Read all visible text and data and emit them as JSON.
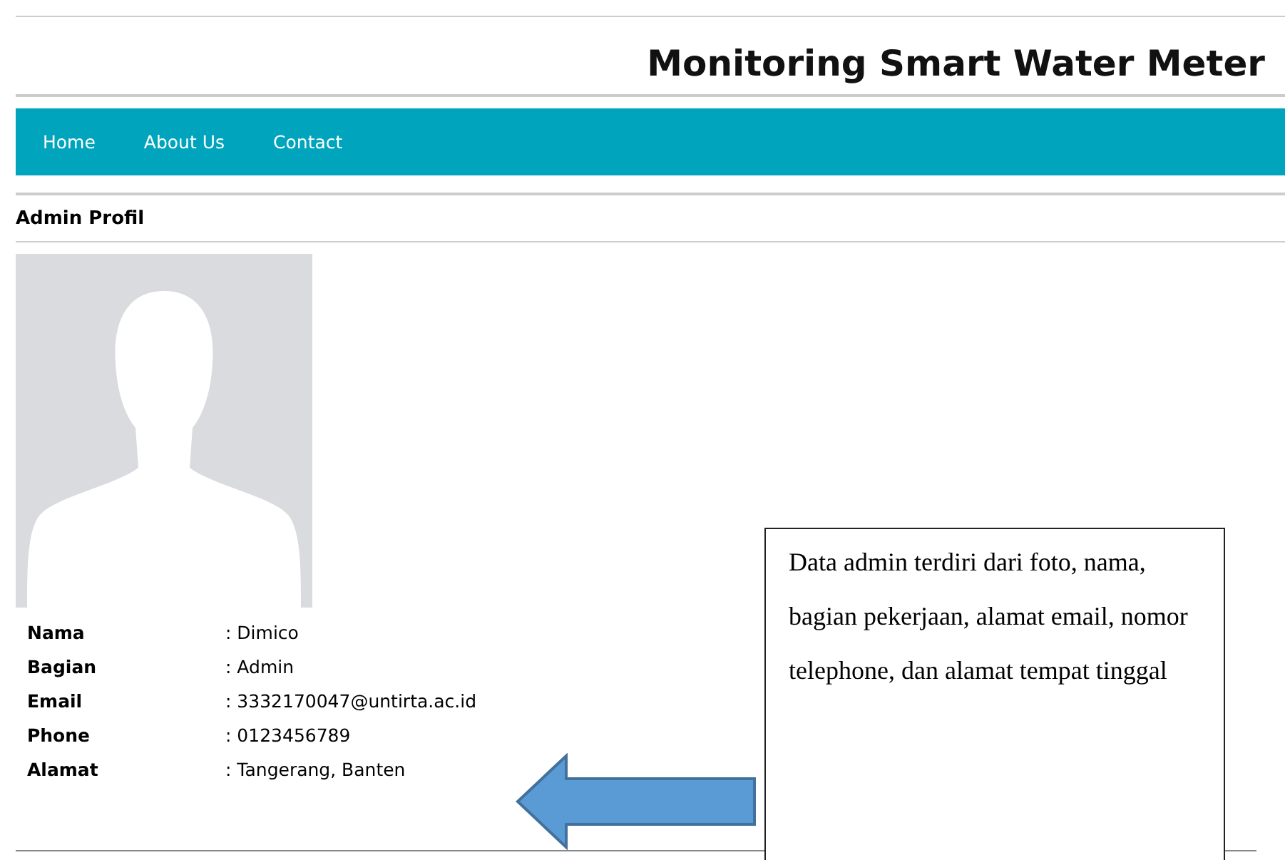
{
  "header": {
    "title": "Monitoring Smart Water Meter"
  },
  "nav": [
    {
      "label": "Home"
    },
    {
      "label": "About Us"
    },
    {
      "label": "Contact"
    }
  ],
  "section_title": "Admin Profil",
  "profile": {
    "photo": {
      "kind": "avatar"
    },
    "fields": [
      {
        "label": "Nama",
        "value": ": Dimico"
      },
      {
        "label": "Bagian",
        "value": ": Admin"
      },
      {
        "label": "Email",
        "value": ": 3332170047@untirta.ac.id"
      },
      {
        "label": "Phone",
        "value": ": 0123456789"
      },
      {
        "label": "Alamat",
        "value": ": Tangerang, Banten"
      }
    ]
  },
  "callout": {
    "text": "Data admin terdiri dari foto, nama, bagian pekerjaan, alamat email, nomor telephone, dan alamat tempat tinggal"
  }
}
